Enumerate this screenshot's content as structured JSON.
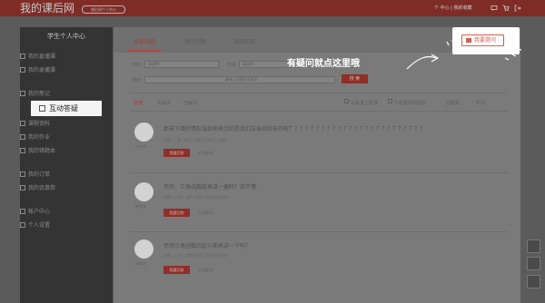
{
  "header": {
    "logo_text": "我的课后网",
    "badge_text": "课后网个人中心",
    "user_menu": "个 中心 | 我的收藏",
    "icons": [
      "message-icon",
      "cart-icon",
      "logout-icon"
    ],
    "bar_color": "#7f2c26"
  },
  "sidebar": {
    "title": "学生个人中心",
    "items": [
      {
        "label": "我的直播课",
        "icon": "live-icon"
      },
      {
        "label": "我的录播课",
        "icon": "video-icon"
      },
      {
        "label": "我的笔记",
        "icon": "note-icon"
      },
      {
        "label": "课程资料",
        "icon": "file-icon"
      },
      {
        "label": "我的作业",
        "icon": "homework-icon"
      },
      {
        "label": "我的错题本",
        "icon": "book-icon"
      },
      {
        "label": "我的订单",
        "icon": "order-icon"
      },
      {
        "label": "我的优惠券",
        "icon": "coupon-icon"
      },
      {
        "label": "帐户中心",
        "icon": "account-icon"
      },
      {
        "label": "个人设置",
        "icon": "settings-icon"
      }
    ],
    "active": {
      "label": "互动答疑",
      "icon": "qa-icon"
    }
  },
  "tabs": [
    {
      "label": "全部问题",
      "active": true
    },
    {
      "label": "我的问题",
      "active": false
    },
    {
      "label": "我的回答",
      "active": false
    }
  ],
  "filters": {
    "subject_label": "学科",
    "subject_value": "请选择",
    "grade_label": "年级",
    "grade_value": "请选择",
    "keyword_label": "搜索",
    "keyword_placeholder": "请输入问题的关键字",
    "search_button": "搜 索"
  },
  "status_filters": [
    "全部",
    "未解决",
    "已解决"
  ],
  "checks": [
    "只看未上的课",
    "只看老师的提问"
  ],
  "sort": [
    "回答数",
    "时间"
  ],
  "questions": [
    {
      "asker": "卢同学",
      "title": "那天下面的情形该如何表示的是我们应该如何去作呢？？？？？？？？？？？？？？？？？？？？？？？？？",
      "meta": "问题  ◯  第一单元  (发表于2年前三道题)",
      "answer_button": "我要回答",
      "count": "+回答(0)"
    },
    {
      "asker": "梅同学",
      "title": "老师，三角函数能再讲一遍吗？我不懂",
      "meta": "问题  ◯  初三 第四  (发表于1年前已回答)",
      "answer_button": "我要回答",
      "count": "+回答(1)"
    },
    {
      "asker": "梅同学",
      "title": "老师三角函数的定义能再讲一下吗？",
      "meta": "问题  ◯  初三 第四  (发表于1年前已回答)",
      "answer_button": "我要回答",
      "count": "+回答(1)"
    }
  ],
  "callout": {
    "ask_button": "我要提问",
    "annotation": "有疑问就点这里哦"
  },
  "float_buttons": [
    "grid-icon",
    "compass-icon",
    "top-icon"
  ]
}
